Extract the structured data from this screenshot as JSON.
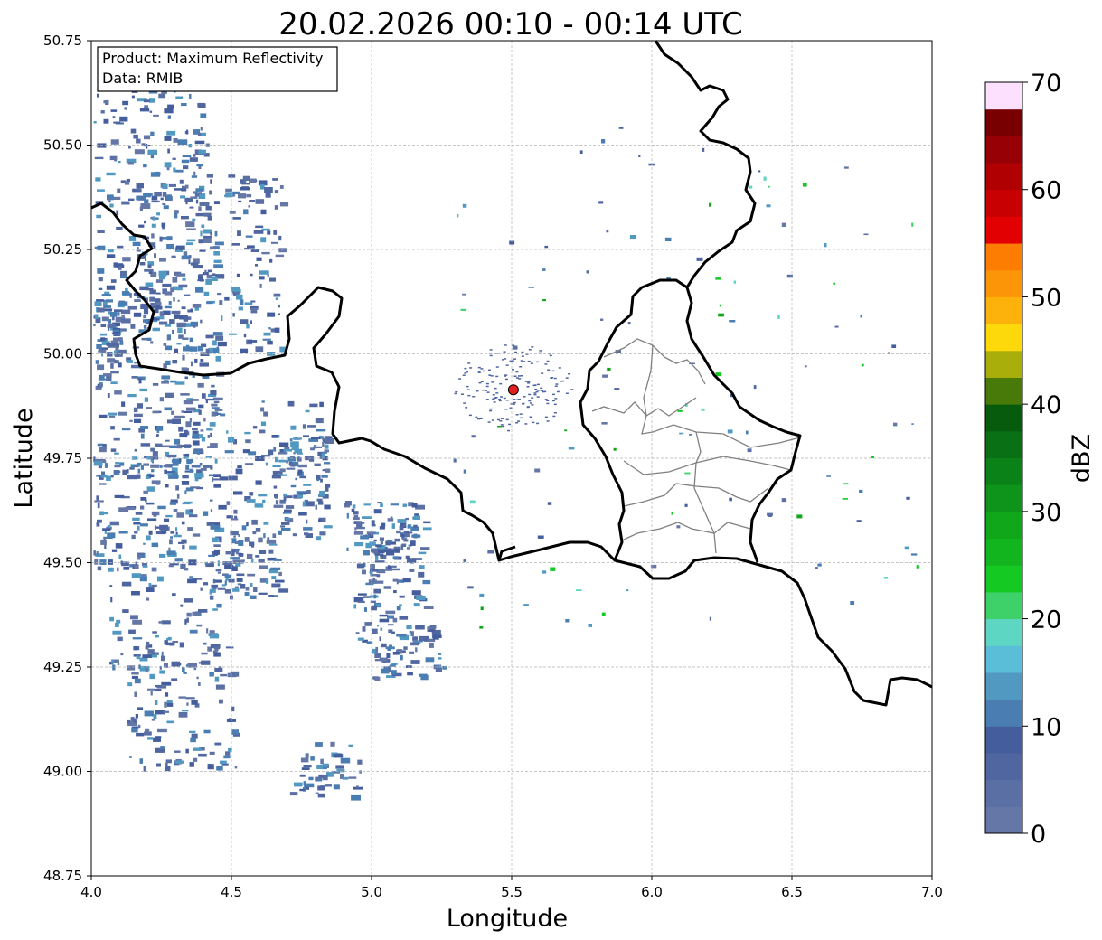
{
  "title": "20.02.2026 00:10 - 00:14 UTC",
  "info_box": {
    "product": "Product: Maximum Reflectivity",
    "data": "Data: RMIB"
  },
  "axes": {
    "xlabel": "Longitude",
    "ylabel": "Latitude",
    "xlim": [
      4.0,
      7.0
    ],
    "ylim": [
      48.75,
      50.75
    ],
    "xticks": [
      "4.0",
      "4.5",
      "5.0",
      "5.5",
      "6.0",
      "6.5",
      "7.0"
    ],
    "yticks": [
      "48.75",
      "49.00",
      "49.25",
      "49.50",
      "49.75",
      "50.00",
      "50.25",
      "50.50",
      "50.75"
    ],
    "grid": true
  },
  "colorbar": {
    "label": "dBZ",
    "ticks": [
      "0",
      "10",
      "20",
      "30",
      "40",
      "50",
      "60",
      "70"
    ],
    "range": [
      0,
      70
    ],
    "step": 2.5,
    "colors": [
      "#6477a6",
      "#5a6fa3",
      "#4f66a0",
      "#445d9d",
      "#4a7db2",
      "#5299c2",
      "#5abed8",
      "#5dd6c4",
      "#3ed16a",
      "#13c922",
      "#12b51e",
      "#10a71a",
      "#0e941a",
      "#0b8218",
      "#0a7016",
      "#075b0d",
      "#487a09",
      "#a9ae0b",
      "#fdd80a",
      "#fdb10b",
      "#fd9509",
      "#fd7c02",
      "#e20003",
      "#c90001",
      "#b00002",
      "#970004",
      "#790000",
      "#fde0fd",
      "#feb0fe",
      "#fe6dfe",
      "#ec2dee"
    ]
  },
  "radar_site": {
    "lon": 5.506,
    "lat": 49.914,
    "color": "#e21f1f"
  }
}
